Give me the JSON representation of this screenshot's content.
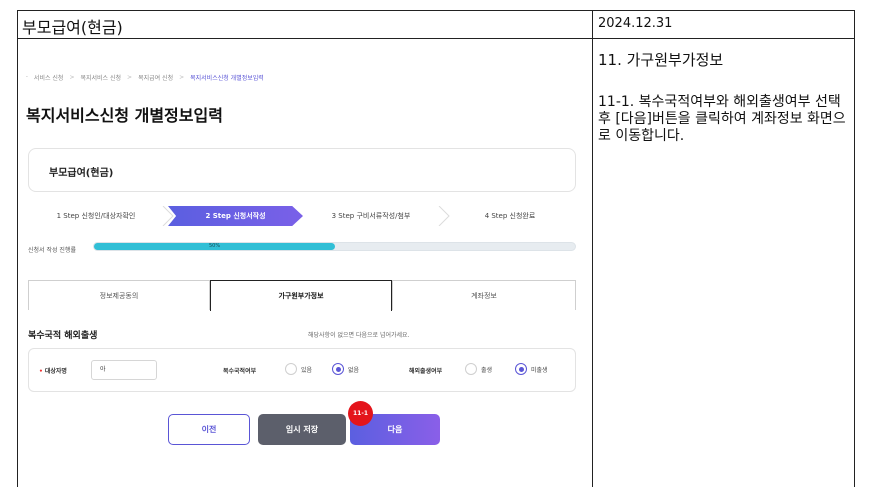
{
  "doc": {
    "title": "부모급여(현금)",
    "date": "2024.12.31",
    "desc_title": "11. 가구원부가정보",
    "desc_body": "11-1. 복수국적여부와 해외출생여부 선택 후 [다음]버튼을 클릭하여 계좌정보 화면으로 이동합니다."
  },
  "breadcrumb": [
    "서비스 신청",
    "복지서비스 신청",
    "복지급여 신청",
    "복지서비스신청 개별정보입력"
  ],
  "page_title": "복지서비스신청 개별정보입력",
  "service_name": "부모급여(현금)",
  "steps": [
    {
      "label": "1 Step 신청인/대상자확인",
      "active": false
    },
    {
      "label": "2 Step 신청서작성",
      "active": true
    },
    {
      "label": "3 Step 구비서류작성/첨부",
      "active": false
    },
    {
      "label": "4 Step 신청완료",
      "active": false
    }
  ],
  "progress": {
    "label": "신청서 작성 진행률",
    "value_text": "50%",
    "value": 0.5,
    "color": "#31bfd6"
  },
  "tabs": [
    {
      "label": "정보제공동의",
      "active": false
    },
    {
      "label": "가구원부가정보",
      "active": true
    },
    {
      "label": "계좌정보",
      "active": false
    }
  ],
  "section": {
    "title": "복수국적 해외출생",
    "note": "해당사항이 없으면 다음으로 넘어가세요."
  },
  "form": {
    "subject_label": "대상자명",
    "subject_value": "아",
    "dual_label": "복수국적여부",
    "dual_yes": "있음",
    "dual_no": "없음",
    "dual_selected": "no",
    "birth_label": "해외출생여부",
    "birth_yes": "출생",
    "birth_no": "미출생",
    "birth_selected": "no"
  },
  "buttons": {
    "prev": "이전",
    "temp_save": "임시 저장",
    "next": "다음"
  },
  "badge": "11-1",
  "colors": {
    "accent": "#5a55d6",
    "badge": "#e4141b",
    "progress": "#31bfd6"
  }
}
